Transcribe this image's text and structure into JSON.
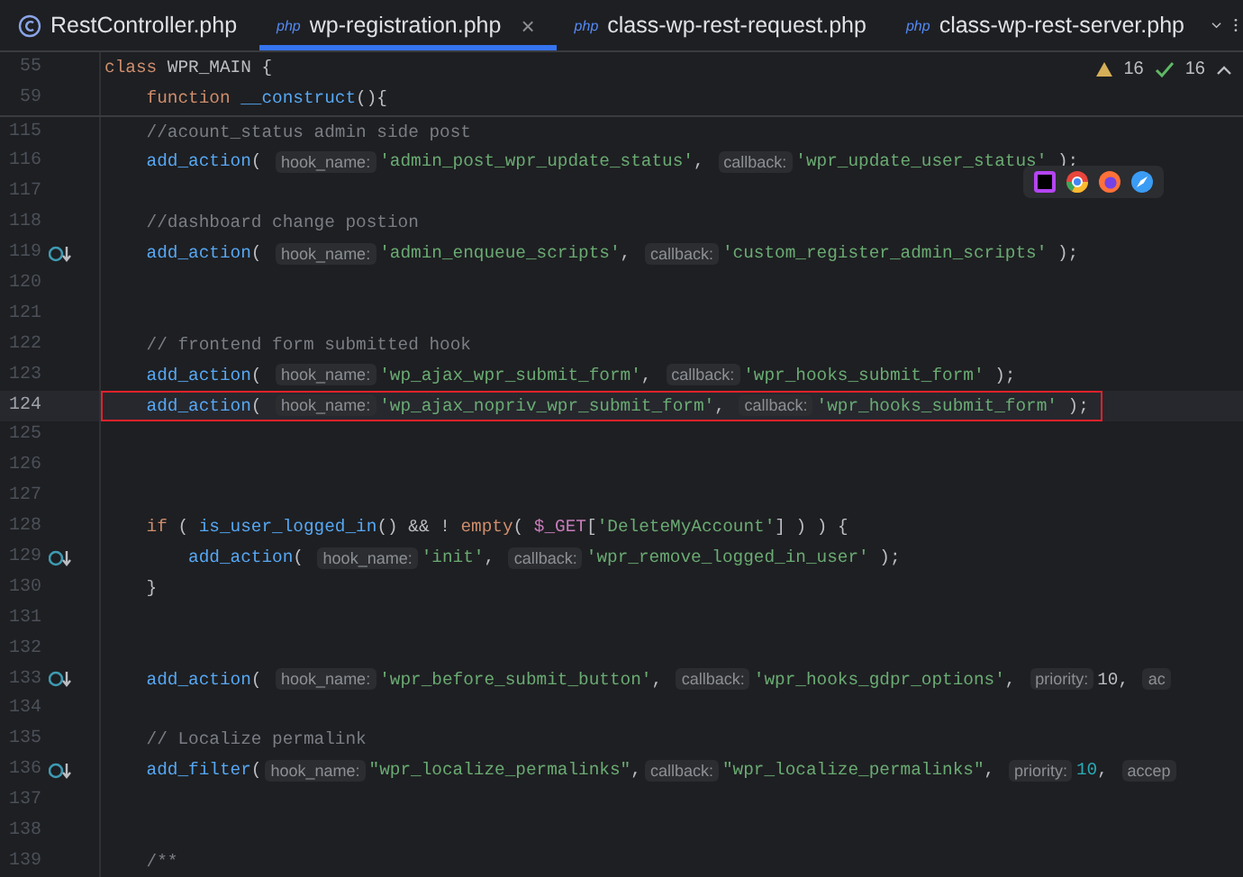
{
  "tabs": [
    {
      "label": "RestController.php",
      "kind": "class",
      "selected": false
    },
    {
      "label": "wp-registration.php",
      "kind": "php",
      "icon_text": "php",
      "selected": true,
      "close": "×"
    },
    {
      "label": "class-wp-rest-request.php",
      "kind": "php",
      "icon_text": "php",
      "selected": false
    },
    {
      "label": "class-wp-rest-server.php",
      "kind": "php",
      "icon_text": "php",
      "selected": false
    }
  ],
  "inspections": {
    "warnings": "16",
    "passed": "16"
  },
  "sticky_lines": [
    {
      "number": "55",
      "tokens": [
        {
          "kind": "keyword",
          "text": "class "
        },
        {
          "kind": "plain",
          "text": "WPR_MAIN {"
        }
      ]
    },
    {
      "number": "59",
      "tokens": [
        {
          "kind": "keyword",
          "text": "    function "
        },
        {
          "kind": "fn_decl",
          "text": "__construct"
        },
        {
          "kind": "plain",
          "text": "(){"
        }
      ]
    }
  ],
  "lines": [
    {
      "number": "115",
      "current": false,
      "annotated": false,
      "gutter_icon": false,
      "tokens": [
        {
          "kind": "comment",
          "text": "    //acount_status admin side post"
        }
      ]
    },
    {
      "number": "116",
      "current": false,
      "annotated": false,
      "gutter_icon": false,
      "tokens": [
        {
          "kind": "fn",
          "text": "    add_action"
        },
        {
          "kind": "plain",
          "text": "( "
        },
        {
          "kind": "hint",
          "text": "hook_name:"
        },
        {
          "kind": "str",
          "text": "'admin_post_wpr_update_status'"
        },
        {
          "kind": "plain",
          "text": ", "
        },
        {
          "kind": "hint",
          "text": "callback:"
        },
        {
          "kind": "str",
          "text": "'wpr_update_user_status'"
        },
        {
          "kind": "plain",
          "text": " );"
        }
      ]
    },
    {
      "number": "117",
      "current": false,
      "annotated": false,
      "gutter_icon": false
    },
    {
      "number": "118",
      "current": false,
      "annotated": false,
      "gutter_icon": false,
      "tokens": [
        {
          "kind": "comment",
          "text": "    //dashboard change postion"
        }
      ]
    },
    {
      "number": "119",
      "current": false,
      "annotated": false,
      "gutter_icon": true,
      "tokens": [
        {
          "kind": "fn",
          "text": "    add_action"
        },
        {
          "kind": "plain",
          "text": "( "
        },
        {
          "kind": "hint",
          "text": "hook_name:"
        },
        {
          "kind": "str",
          "text": "'admin_enqueue_scripts'"
        },
        {
          "kind": "plain",
          "text": ", "
        },
        {
          "kind": "hint",
          "text": "callback:"
        },
        {
          "kind": "str",
          "text": "'custom_register_admin_scripts'"
        },
        {
          "kind": "plain",
          "text": " );"
        }
      ]
    },
    {
      "number": "120",
      "current": false,
      "annotated": false,
      "gutter_icon": false
    },
    {
      "number": "121",
      "current": false,
      "annotated": false,
      "gutter_icon": false
    },
    {
      "number": "122",
      "current": false,
      "annotated": false,
      "gutter_icon": false,
      "tokens": [
        {
          "kind": "comment",
          "text": "    // frontend form submitted hook"
        }
      ]
    },
    {
      "number": "123",
      "current": false,
      "annotated": false,
      "gutter_icon": false,
      "tokens": [
        {
          "kind": "fn",
          "text": "    add_action"
        },
        {
          "kind": "plain",
          "text": "( "
        },
        {
          "kind": "hint",
          "text": "hook_name:"
        },
        {
          "kind": "str",
          "text": "'wp_ajax_wpr_submit_form'"
        },
        {
          "kind": "plain",
          "text": ", "
        },
        {
          "kind": "hint",
          "text": "callback:"
        },
        {
          "kind": "str",
          "text": "'wpr_hooks_submit_form'"
        },
        {
          "kind": "plain",
          "text": " );"
        }
      ]
    },
    {
      "number": "124",
      "current": true,
      "annotated": true,
      "gutter_icon": false,
      "tokens": [
        {
          "kind": "fn",
          "text": "    add_action"
        },
        {
          "kind": "plain",
          "text": "( "
        },
        {
          "kind": "hint",
          "text": "hook_name:"
        },
        {
          "kind": "str",
          "text": "'wp_ajax_nopriv_wpr_submit_form'"
        },
        {
          "kind": "plain",
          "text": ", "
        },
        {
          "kind": "hint",
          "text": "callback:"
        },
        {
          "kind": "str",
          "text": "'wpr_hooks_submit_form'"
        },
        {
          "kind": "plain",
          "text": " );"
        }
      ]
    },
    {
      "number": "125",
      "current": false,
      "annotated": false,
      "gutter_icon": false
    },
    {
      "number": "126",
      "current": false,
      "annotated": false,
      "gutter_icon": false
    },
    {
      "number": "127",
      "current": false,
      "annotated": false,
      "gutter_icon": false
    },
    {
      "number": "128",
      "current": false,
      "annotated": false,
      "gutter_icon": false,
      "tokens": [
        {
          "kind": "keyword",
          "text": "    if"
        },
        {
          "kind": "plain",
          "text": " ( "
        },
        {
          "kind": "fn",
          "text": "is_user_logged_in"
        },
        {
          "kind": "plain",
          "text": "() && ! "
        },
        {
          "kind": "keyword",
          "text": "empty"
        },
        {
          "kind": "plain",
          "text": "( "
        },
        {
          "kind": "var",
          "text": "$_GET"
        },
        {
          "kind": "plain",
          "text": "["
        },
        {
          "kind": "str",
          "text": "'DeleteMyAccount'"
        },
        {
          "kind": "plain",
          "text": "] ) ) {"
        }
      ]
    },
    {
      "number": "129",
      "current": false,
      "annotated": false,
      "gutter_icon": true,
      "tokens": [
        {
          "kind": "fn",
          "text": "        add_action"
        },
        {
          "kind": "plain",
          "text": "( "
        },
        {
          "kind": "hint",
          "text": "hook_name:"
        },
        {
          "kind": "str",
          "text": "'init'"
        },
        {
          "kind": "plain",
          "text": ", "
        },
        {
          "kind": "hint",
          "text": "callback:"
        },
        {
          "kind": "str",
          "text": "'wpr_remove_logged_in_user'"
        },
        {
          "kind": "plain",
          "text": " );"
        }
      ]
    },
    {
      "number": "130",
      "current": false,
      "annotated": false,
      "gutter_icon": false,
      "tokens": [
        {
          "kind": "plain",
          "text": "    }"
        }
      ]
    },
    {
      "number": "131",
      "current": false,
      "annotated": false,
      "gutter_icon": false
    },
    {
      "number": "132",
      "current": false,
      "annotated": false,
      "gutter_icon": false
    },
    {
      "number": "133",
      "current": false,
      "annotated": false,
      "gutter_icon": true,
      "tokens": [
        {
          "kind": "fn",
          "text": "    add_action"
        },
        {
          "kind": "plain",
          "text": "( "
        },
        {
          "kind": "hint",
          "text": "hook_name:"
        },
        {
          "kind": "str",
          "text": "'wpr_before_submit_button'"
        },
        {
          "kind": "plain",
          "text": ", "
        },
        {
          "kind": "hint",
          "text": "callback:"
        },
        {
          "kind": "str",
          "text": "'wpr_hooks_gdpr_options'"
        },
        {
          "kind": "plain",
          "text": ", "
        },
        {
          "kind": "hint",
          "text": "priority:"
        },
        {
          "kind": "plain",
          "text": "10, "
        },
        {
          "kind": "hint",
          "text": "ac"
        }
      ]
    },
    {
      "number": "134",
      "current": false,
      "annotated": false,
      "gutter_icon": false
    },
    {
      "number": "135",
      "current": false,
      "annotated": false,
      "gutter_icon": false,
      "tokens": [
        {
          "kind": "comment",
          "text": "    // Localize permalink"
        }
      ]
    },
    {
      "number": "136",
      "current": false,
      "annotated": false,
      "gutter_icon": true,
      "tokens": [
        {
          "kind": "fn",
          "text": "    add_filter"
        },
        {
          "kind": "plain",
          "text": "("
        },
        {
          "kind": "hint",
          "text": "hook_name:"
        },
        {
          "kind": "str",
          "text": "\"wpr_localize_permalinks\""
        },
        {
          "kind": "plain",
          "text": ","
        },
        {
          "kind": "hint",
          "text": "callback:"
        },
        {
          "kind": "str",
          "text": "\"wpr_localize_permalinks\""
        },
        {
          "kind": "plain",
          "text": ", "
        },
        {
          "kind": "hint",
          "text": "priority:"
        },
        {
          "kind": "num",
          "text": "10"
        },
        {
          "kind": "plain",
          "text": ", "
        },
        {
          "kind": "hint",
          "text": "accep"
        }
      ]
    },
    {
      "number": "137",
      "current": false,
      "annotated": false,
      "gutter_icon": false
    },
    {
      "number": "138",
      "current": false,
      "annotated": false,
      "gutter_icon": false
    },
    {
      "number": "139",
      "current": false,
      "annotated": false,
      "gutter_icon": false,
      "tokens": [
        {
          "kind": "comment",
          "text": "    /**"
        }
      ]
    }
  ]
}
